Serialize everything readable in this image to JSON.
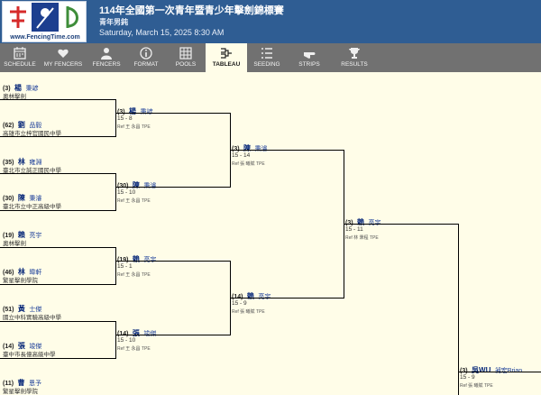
{
  "header": {
    "logo_text": "www.FencingTime.com",
    "title": "114年全國第一次青年暨青少年擊劍錦標賽",
    "subtitle": "青年男鈍",
    "date": "Saturday, March 15, 2025 8:30 AM",
    "colors": {
      "bar": "#2f5d93",
      "flag_red": "#d62b2b",
      "flag_blue": "#1d3f8f",
      "flag_green": "#3e8d3a"
    }
  },
  "nav": {
    "active_tab": "TABLEAU",
    "tabs": [
      {
        "label": "SCHEDULE",
        "icon": "calendar-icon"
      },
      {
        "label": "MY FENCERS",
        "icon": "heart-icon"
      },
      {
        "label": "FENCERS",
        "icon": "person-icon"
      },
      {
        "label": "FORMAT",
        "icon": "info-icon"
      },
      {
        "label": "POOLS",
        "icon": "grid-icon"
      },
      {
        "label": "TABLEAU",
        "icon": "bracket-icon"
      },
      {
        "label": "SEEDING",
        "icon": "list-icon"
      },
      {
        "label": "STRIPS",
        "icon": "pointing-hand-icon"
      },
      {
        "label": "RESULTS",
        "icon": "trophy-icon"
      }
    ]
  },
  "bracket": {
    "entrants": [
      {
        "seed": "(3)",
        "surname": "楊",
        "given": "秉諺",
        "club": "奧林擊劍"
      },
      {
        "seed": "(62)",
        "surname": "劉",
        "given": "品毅",
        "club": "高雄市立梓官國民中學"
      },
      {
        "seed": "(35)",
        "surname": "林",
        "given": "雍淵",
        "club": "臺北市立誠正國民中學"
      },
      {
        "seed": "(30)",
        "surname": "陳",
        "given": "秉濬",
        "club": "臺北市立中正高級中學"
      },
      {
        "seed": "(19)",
        "surname": "賴",
        "given": "亮宇",
        "club": "奧林擊劍"
      },
      {
        "seed": "(46)",
        "surname": "林",
        "given": "暐軒",
        "club": "繁星擊劍學院"
      },
      {
        "seed": "(51)",
        "surname": "黃",
        "given": "士傑",
        "club": "國立中科實驗高級中學"
      },
      {
        "seed": "(14)",
        "surname": "張",
        "given": "竣傑",
        "club": "臺中市長億高級中學"
      },
      {
        "seed": "(11)",
        "surname": "曹",
        "given": "恩予",
        "club": "繁星擊劍學院"
      }
    ],
    "round2": [
      {
        "seed": "(3)",
        "surname": "楊",
        "given": "秉諺",
        "score": "15 - 8",
        "ref": "Ref 王 永昌 TPE"
      },
      {
        "seed": "(30)",
        "surname": "陳",
        "given": "秉濬",
        "score": "15 - 10",
        "ref": "Ref 王 永昌 TPE"
      },
      {
        "seed": "(19)",
        "surname": "賴",
        "given": "亮宇",
        "score": "15 - 1",
        "ref": "Ref 王 永昌 TPE"
      },
      {
        "seed": "(14)",
        "surname": "張",
        "given": "竣傑",
        "score": "15 - 10",
        "ref": "Ref 王 永昌 TPE"
      }
    ],
    "round3": [
      {
        "seed": "(3)",
        "surname": "陳",
        "given": "秉濬",
        "score": "15 - 14",
        "ref": "Ref 張 曦賦 TPE"
      },
      {
        "seed": "(14)",
        "surname": "賴",
        "given": "亮宇",
        "score": "15 - 9",
        "ref": "Ref 張 曦賦 TPE"
      }
    ],
    "round4": [
      {
        "seed": "(3)",
        "surname": "賴",
        "given": "亮宇",
        "score": "15 - 11",
        "ref": "Ref 林 秉程 TPE"
      }
    ],
    "round5": [
      {
        "seed": "(3)",
        "surname": "吳WU",
        "given": "昶宏Brian",
        "score": "15 - 9",
        "ref": "Ref 張 曦賦 TPE"
      }
    ]
  }
}
